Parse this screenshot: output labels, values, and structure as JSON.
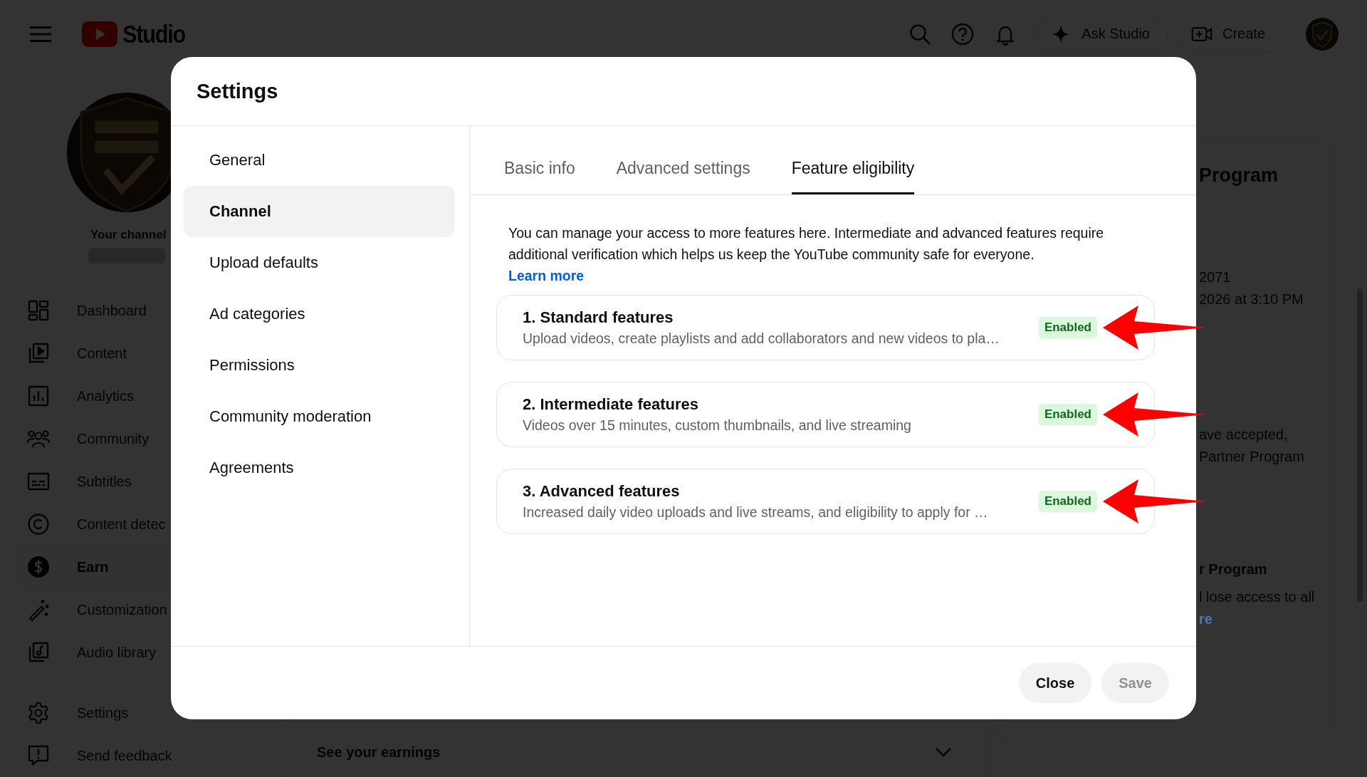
{
  "topbar": {
    "logo_text": "Studio",
    "ask_studio": "Ask Studio",
    "create": "Create"
  },
  "sidebar": {
    "channel_label": "Your channel",
    "items": [
      {
        "label": "Dashboard",
        "selected": false
      },
      {
        "label": "Content",
        "selected": false
      },
      {
        "label": "Analytics",
        "selected": false
      },
      {
        "label": "Community",
        "selected": false
      },
      {
        "label": "Subtitles",
        "selected": false
      },
      {
        "label": "Content detec",
        "selected": false
      },
      {
        "label": "Earn",
        "selected": true
      },
      {
        "label": "Customization",
        "selected": false
      },
      {
        "label": "Audio library",
        "selected": false
      }
    ],
    "footer_items": [
      {
        "label": "Settings"
      },
      {
        "label": "Send feedback"
      }
    ]
  },
  "main": {
    "earnings_row": "See your earnings"
  },
  "right_card": {
    "title": "Program",
    "lines": [
      "2071",
      "2026 at 3:10 PM"
    ],
    "lines_2": [
      "ave accepted,",
      "Partner Program"
    ],
    "title_2": "r Program",
    "lines_3": [
      "l lose access to all"
    ],
    "link": "re"
  },
  "dialog": {
    "title": "Settings",
    "nav": [
      {
        "label": "General",
        "selected": false
      },
      {
        "label": "Channel",
        "selected": true
      },
      {
        "label": "Upload defaults",
        "selected": false
      },
      {
        "label": "Ad categories",
        "selected": false
      },
      {
        "label": "Permissions",
        "selected": false
      },
      {
        "label": "Community moderation",
        "selected": false
      },
      {
        "label": "Agreements",
        "selected": false
      }
    ],
    "tabs": [
      {
        "label": "Basic info",
        "selected": false
      },
      {
        "label": "Advanced settings",
        "selected": false
      },
      {
        "label": "Feature eligibility",
        "selected": true
      }
    ],
    "intro": "You can manage your access to more features here. Intermediate and advanced features require additional verification which helps us keep the YouTube community safe for everyone.",
    "learn_more": "Learn more",
    "features": [
      {
        "title": "1. Standard features",
        "description": "Upload videos, create playlists and add collaborators and new videos to pla…",
        "status": "Enabled",
        "highlighted": true
      },
      {
        "title": "2. Intermediate features",
        "description": "Videos over 15 minutes, custom thumbnails, and live streaming",
        "status": "Enabled",
        "highlighted": true
      },
      {
        "title": "3. Advanced features",
        "description": "Increased daily video uploads and live streams, and eligibility to apply for …",
        "status": "Enabled",
        "highlighted": true
      }
    ],
    "buttons": [
      {
        "label": "Close",
        "disabled": false
      },
      {
        "label": "Save",
        "disabled": true
      }
    ]
  }
}
